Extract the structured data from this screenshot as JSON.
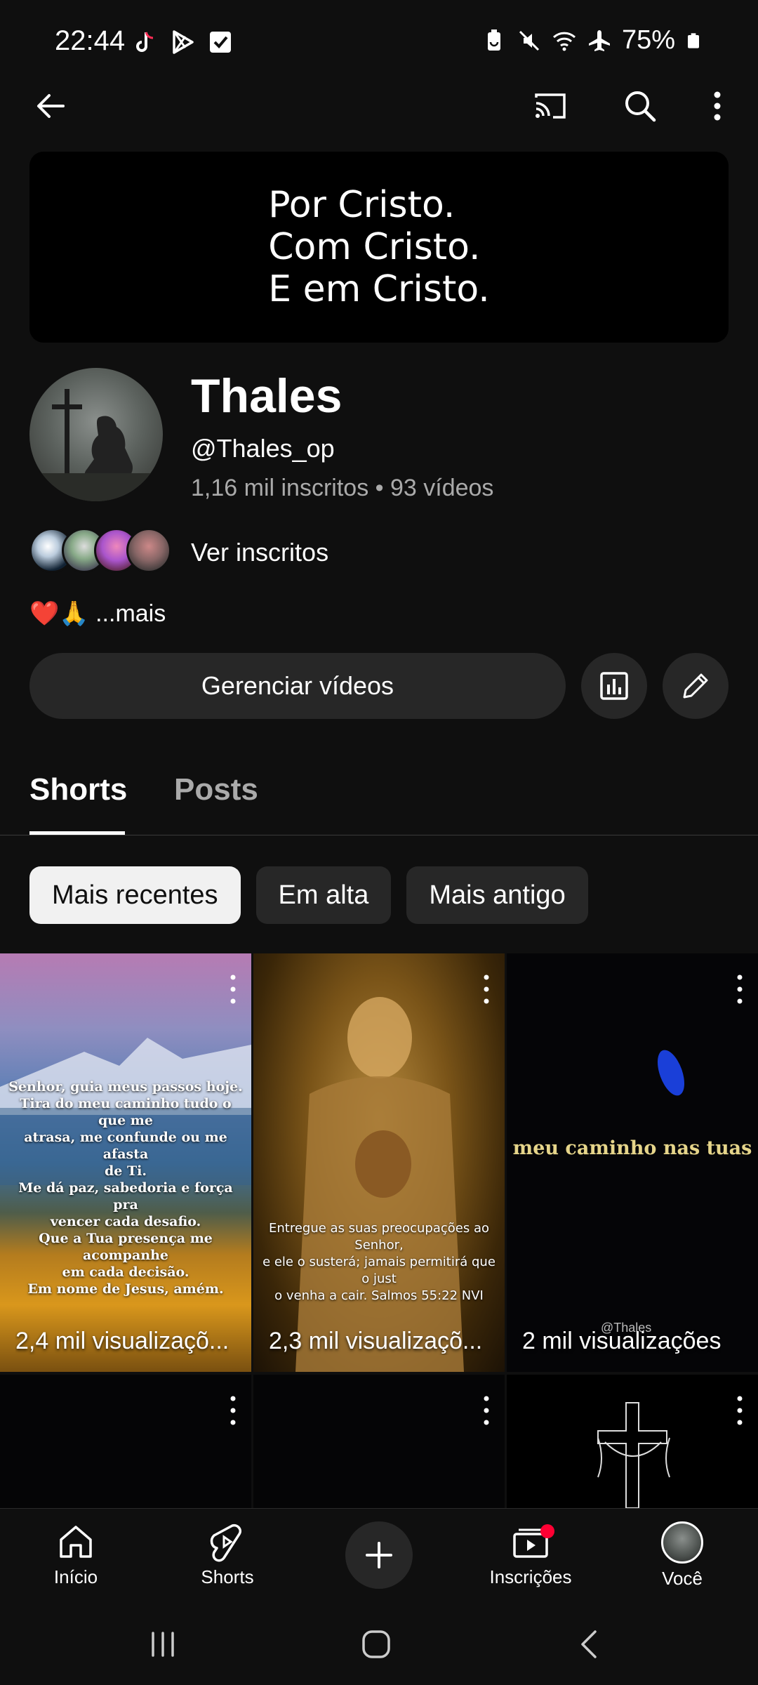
{
  "status_bar": {
    "time": "22:44",
    "battery": "75%",
    "app_icons": [
      "tiktok-icon",
      "play-store-icon",
      "checkbox-icon"
    ],
    "right_icons": [
      "battery-saver-icon",
      "mute-icon",
      "wifi-icon",
      "airplane-icon",
      "battery-icon"
    ]
  },
  "top_bar": {
    "icons": [
      "back-arrow-icon",
      "cast-icon",
      "search-icon",
      "more-vert-icon"
    ]
  },
  "banner": {
    "line1": "Por Cristo.",
    "line2": "Com Cristo.",
    "line3": "E em Cristo."
  },
  "channel": {
    "name": "Thales",
    "handle": "@Thales_op",
    "stats": "1,16 mil inscritos • 93 vídeos",
    "subscribers_link": "Ver inscritos",
    "bio": "❤️🙏 ...mais"
  },
  "actions": {
    "manage_label": "Gerenciar vídeos",
    "icons": [
      "analytics-icon",
      "edit-pencil-icon"
    ]
  },
  "tabs": [
    {
      "label": "Shorts",
      "active": true
    },
    {
      "label": "Posts",
      "active": false
    }
  ],
  "sort_chips": [
    {
      "label": "Mais recentes",
      "selected": true
    },
    {
      "label": "Em alta",
      "selected": false
    },
    {
      "label": "Mais antigo",
      "selected": false
    }
  ],
  "shorts": [
    {
      "views": "2,4 mil visualizaçõ...",
      "overlay_lines": [
        "Senhor, guia meus passos hoje.",
        "Tira do meu caminho tudo o que me",
        "atrasa, me confunde ou me afasta",
        "de Ti.",
        "Me dá paz, sabedoria e força pra",
        "vencer cada desafio.",
        "Que a Tua presença me acompanhe",
        "em cada decisão.",
        "Em nome de Jesus, amém."
      ]
    },
    {
      "views": "2,3 mil visualizaçõ...",
      "overlay_lines": [
        "Entregue as suas preocupações ao Senhor,",
        "e ele o susterá; jamais permitirá que o just",
        "o venha a cair. Salmos 55:22 NVI"
      ]
    },
    {
      "views": "2 mil visualizações",
      "overlay_text": "meu caminho nas tuas",
      "watermark": "@Thales"
    }
  ],
  "bottom_nav": [
    {
      "label": "Início",
      "icon": "home-icon"
    },
    {
      "label": "Shorts",
      "icon": "shorts-icon"
    },
    {
      "label": "",
      "icon": "create-plus-icon"
    },
    {
      "label": "Inscrições",
      "icon": "subscriptions-icon"
    },
    {
      "label": "Você",
      "icon": "you-avatar"
    }
  ],
  "system_nav": [
    "recent-apps-icon",
    "home-button-icon",
    "back-button-icon"
  ]
}
